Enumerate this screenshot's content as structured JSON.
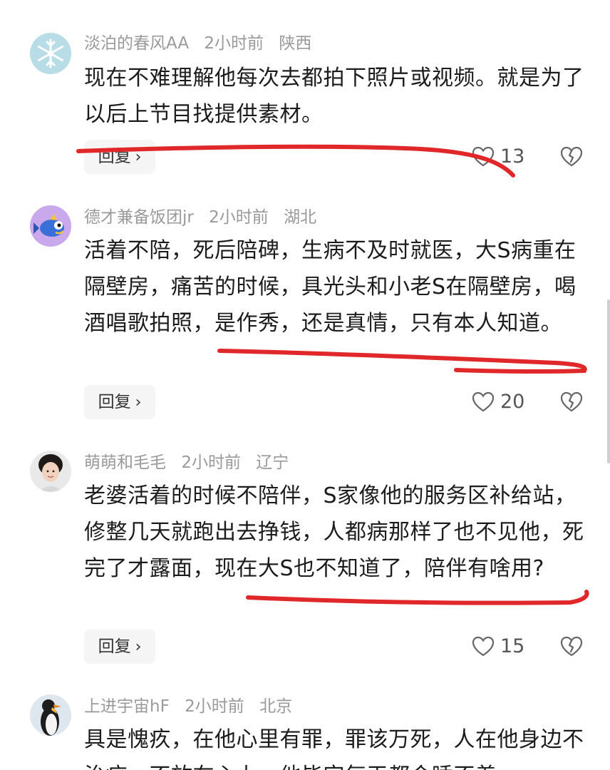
{
  "comments": [
    {
      "username": "淡泊的春风AA",
      "time": "2小时前",
      "location": "陕西",
      "text": "现在不难理解他每次去都拍下照片或视频。就是为了以后上节目找提供素材。",
      "reply_label": "回复",
      "likes": "13",
      "avatar_icon": "snowflake-icon"
    },
    {
      "username": "德才兼备饭团jr",
      "time": "2小时前",
      "location": "湖北",
      "text": "活着不陪，死后陪碑，生病不及时就医，大S病重在隔壁房，痛苦的时候，具光头和小老S在隔壁房，喝酒唱歌拍照，是作秀，还是真情，只有本人知道。",
      "reply_label": "回复",
      "likes": "20",
      "avatar_icon": "fish-icon"
    },
    {
      "username": "萌萌和毛毛",
      "time": "2小时前",
      "location": "辽宁",
      "text": "老婆活着的时候不陪伴，S家像他的服务区补给站，修整几天就跑出去挣钱，人都病那样了也不见他，死完了才露面，现在大S也不知道了，陪伴有啥用?",
      "reply_label": "回复",
      "likes": "15",
      "avatar_icon": "person-photo-icon"
    },
    {
      "username": "上进宇宙hF",
      "time": "2小时前",
      "location": "北京",
      "text": "具是愧疚，在他心里有罪，罪该万死，人在他身边不治疗，不放在心上，他毕定每天都会睡不着",
      "avatar_icon": "penguin-icon"
    }
  ],
  "colors": {
    "annotation_red": "#e0282b",
    "meta_gray": "#9a9a9a",
    "text": "#1c1c1c"
  }
}
